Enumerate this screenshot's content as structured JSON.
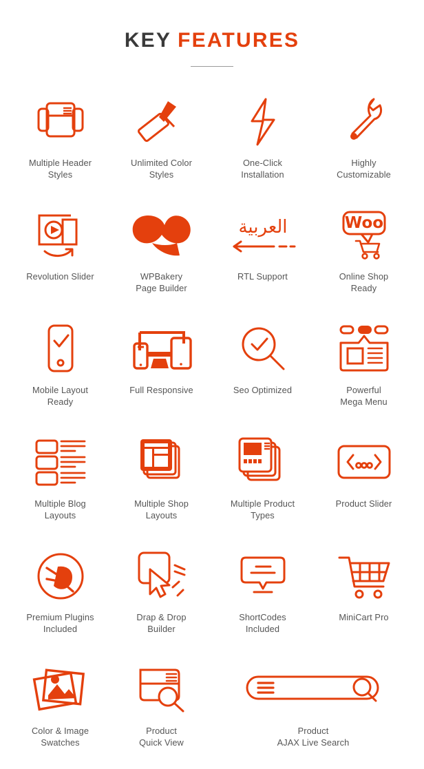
{
  "header": {
    "title_part1": "KEY",
    "title_part2": "FEATURES",
    "colors": {
      "accent": "#e4400d",
      "title_dark": "#3a3a3a",
      "label_text": "#555555",
      "rule": "#9a9a9a",
      "background": "#ffffff"
    }
  },
  "features": [
    {
      "icon": "multiple-header-styles-icon",
      "label": "Multiple Header\nStyles"
    },
    {
      "icon": "paint-roller-icon",
      "label": "Unlimited Color\nStyles"
    },
    {
      "icon": "lightning-bolt-icon",
      "label": "One-Click\nInstallation"
    },
    {
      "icon": "wrench-icon",
      "label": "Highly\nCustomizable"
    },
    {
      "icon": "revolution-slider-icon",
      "label": "Revolution Slider"
    },
    {
      "icon": "wpbakery-icon",
      "label": "WPBakery\nPage Builder"
    },
    {
      "icon": "rtl-arabic-icon",
      "label": "RTL Support",
      "glyph": "العربية"
    },
    {
      "icon": "woocommerce-cart-icon",
      "label": "Online Shop\nReady",
      "glyph": "Woo"
    },
    {
      "icon": "mobile-check-icon",
      "label": "Mobile Layout\nReady"
    },
    {
      "icon": "responsive-devices-icon",
      "label": "Full Responsive"
    },
    {
      "icon": "seo-magnifier-check-icon",
      "label": "Seo Optimized"
    },
    {
      "icon": "mega-menu-icon",
      "label": "Powerful\nMega Menu"
    },
    {
      "icon": "blog-list-layout-icon",
      "label": "Multiple Blog\nLayouts"
    },
    {
      "icon": "stacked-pages-icon",
      "label": "Multiple Shop\nLayouts"
    },
    {
      "icon": "product-types-icon",
      "label": "Multiple Product\nTypes"
    },
    {
      "icon": "product-slider-icon",
      "label": "Product Slider"
    },
    {
      "icon": "plugin-plug-icon",
      "label": "Premium Plugins\nIncluded"
    },
    {
      "icon": "drag-drop-cursor-icon",
      "label": "Drap & Drop\nBuilder"
    },
    {
      "icon": "shortcode-bubble-icon",
      "label": "ShortCodes\nIncluded"
    },
    {
      "icon": "minicart-icon",
      "label": "MiniCart Pro"
    },
    {
      "icon": "photo-swatches-icon",
      "label": "Color & Image\nSwatches"
    },
    {
      "icon": "quick-view-card-icon",
      "label": "Product\nQuick View"
    },
    {
      "icon": "ajax-search-bar-icon",
      "label": "Product\nAJAX Live Search"
    }
  ]
}
